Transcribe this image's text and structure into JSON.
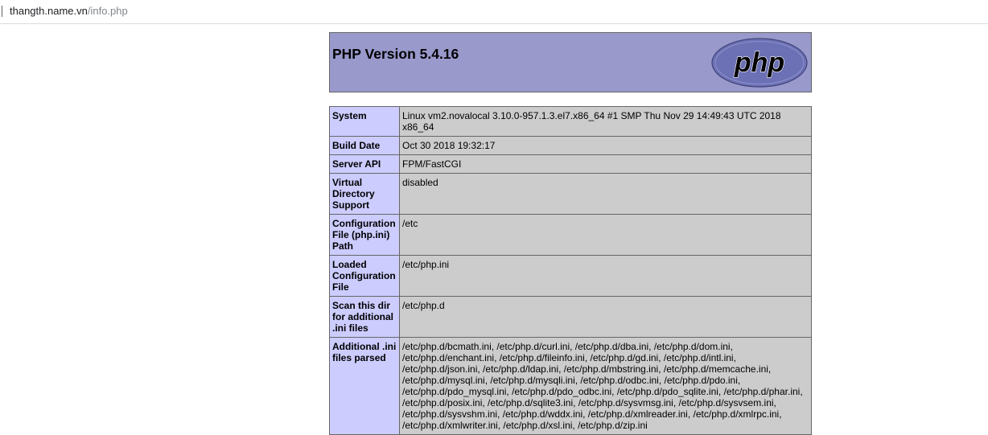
{
  "browser": {
    "url_host": "thangth.name.vn",
    "url_path": "/info.php"
  },
  "header": {
    "title": "PHP Version 5.4.16",
    "logo_text": "php"
  },
  "rows": [
    {
      "label": "System",
      "value": "Linux vm2.novalocal 3.10.0-957.1.3.el7.x86_64 #1 SMP Thu Nov 29 14:49:43 UTC 2018 x86_64"
    },
    {
      "label": "Build Date",
      "value": "Oct 30 2018 19:32:17"
    },
    {
      "label": "Server API",
      "value": "FPM/FastCGI"
    },
    {
      "label": "Virtual Directory Support",
      "value": "disabled"
    },
    {
      "label": "Configuration File (php.ini) Path",
      "value": "/etc"
    },
    {
      "label": "Loaded Configuration File",
      "value": "/etc/php.ini"
    },
    {
      "label": "Scan this dir for additional .ini files",
      "value": "/etc/php.d"
    },
    {
      "label": "Additional .ini files parsed",
      "value": "/etc/php.d/bcmath.ini, /etc/php.d/curl.ini, /etc/php.d/dba.ini, /etc/php.d/dom.ini, /etc/php.d/enchant.ini, /etc/php.d/fileinfo.ini, /etc/php.d/gd.ini, /etc/php.d/intl.ini, /etc/php.d/json.ini, /etc/php.d/ldap.ini, /etc/php.d/mbstring.ini, /etc/php.d/memcache.ini, /etc/php.d/mysql.ini, /etc/php.d/mysqli.ini, /etc/php.d/odbc.ini, /etc/php.d/pdo.ini, /etc/php.d/pdo_mysql.ini, /etc/php.d/pdo_odbc.ini, /etc/php.d/pdo_sqlite.ini, /etc/php.d/phar.ini, /etc/php.d/posix.ini, /etc/php.d/sqlite3.ini, /etc/php.d/sysvmsg.ini, /etc/php.d/sysvsem.ini, /etc/php.d/sysvshm.ini, /etc/php.d/wddx.ini, /etc/php.d/xmlreader.ini, /etc/php.d/xmlrpc.ini, /etc/php.d/xmlwriter.ini, /etc/php.d/xsl.ini, /etc/php.d/zip.ini"
    }
  ],
  "colors": {
    "header_bg": "#9999cc",
    "label_bg": "#ccccff",
    "value_bg": "#cccccc",
    "logo_fill": "#6c71b5"
  }
}
